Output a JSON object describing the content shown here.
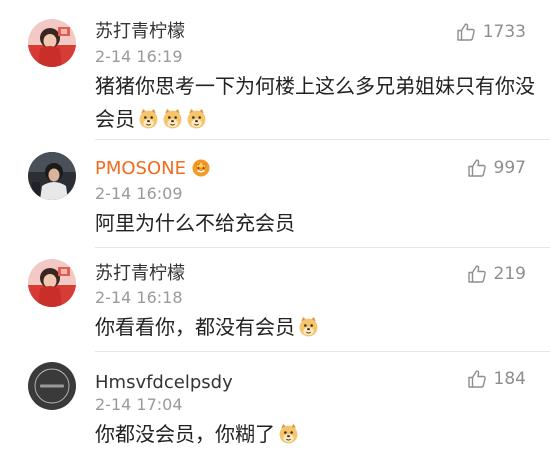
{
  "comments": [
    {
      "username": "苏打青柠檬",
      "time": "2-14 16:19",
      "text": "猪猪你思考一下为何楼上这么多兄弟姐妹只有你没会员",
      "likes": "1733",
      "emoji": "doge-emoji",
      "emoji_count": 3
    },
    {
      "username": "PMOSONE",
      "time": "2-14 16:09",
      "text": "阿里为什么不给充会员",
      "likes": "997",
      "vip": true
    },
    {
      "username": "苏打青柠檬",
      "time": "2-14 16:18",
      "text": "你看看你，都没有会员",
      "likes": "219",
      "emoji": "doge-emoji",
      "emoji_count": 1
    },
    {
      "username": "Hmsvfdcelpsdy",
      "time": "2-14 17:04",
      "text": "你都没会员，你糊了",
      "likes": "184",
      "emoji": "doge-emoji",
      "emoji_count": 1
    }
  ],
  "colors": {
    "vip_name": "#f26b1f",
    "text": "#222222",
    "meta": "#9a9a9a"
  }
}
